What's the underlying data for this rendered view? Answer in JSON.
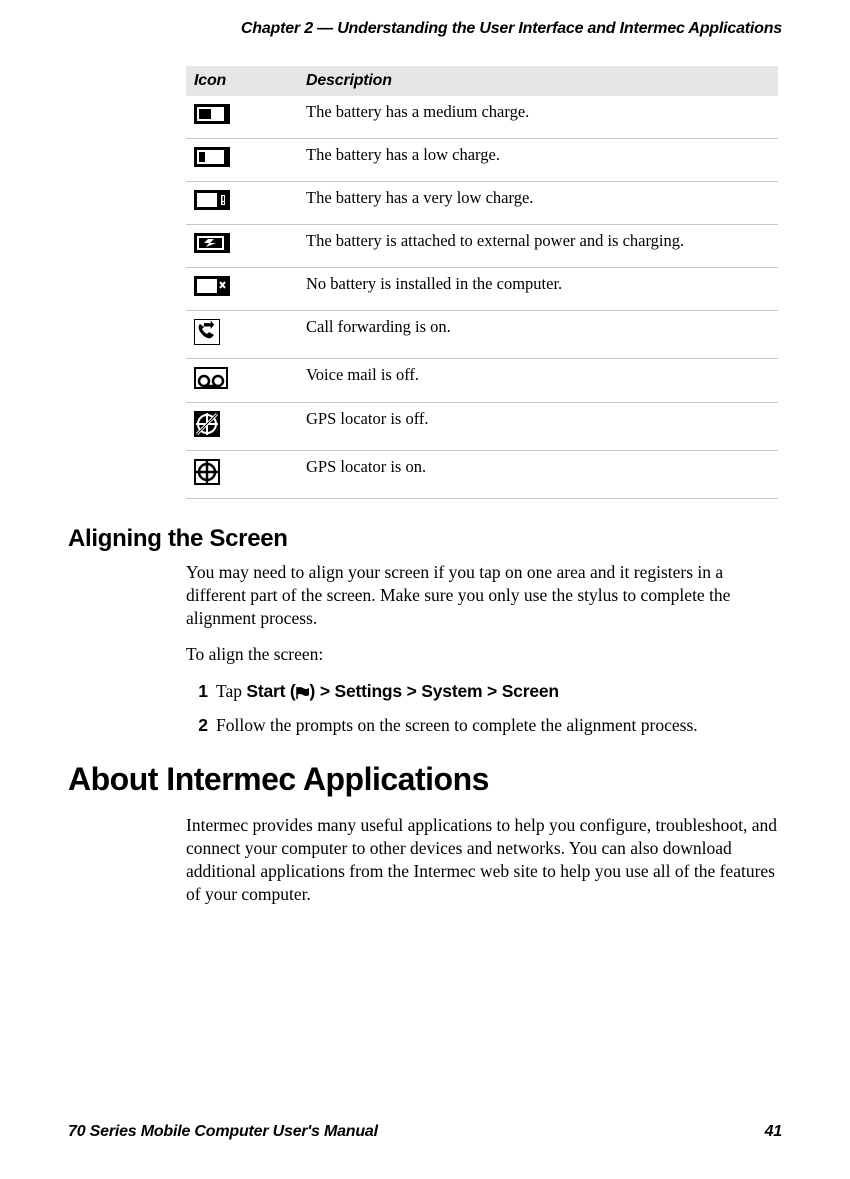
{
  "chapter_header": "Chapter 2 — Understanding the User Interface and Intermec Applications",
  "table": {
    "headers": {
      "icon": "Icon",
      "desc": "Description"
    },
    "rows": [
      {
        "icon": "battery-medium",
        "desc": "The battery has a medium charge."
      },
      {
        "icon": "battery-low",
        "desc": "The battery has a low charge."
      },
      {
        "icon": "battery-verylow",
        "desc": "The battery has a very low charge."
      },
      {
        "icon": "battery-charging",
        "desc": "The battery is attached to external power and is charging."
      },
      {
        "icon": "battery-missing",
        "desc": "No battery is installed in the computer."
      },
      {
        "icon": "call-forwarding",
        "desc": "Call forwarding is on."
      },
      {
        "icon": "voicemail-off",
        "desc": "Voice mail is off."
      },
      {
        "icon": "gps-off",
        "desc": "GPS locator is off."
      },
      {
        "icon": "gps-on",
        "desc": "GPS locator is on."
      }
    ]
  },
  "section1": {
    "heading": "Aligning the Screen",
    "p1": "You may need to align your screen if you tap on one area and it registers in a different part of the screen. Make sure you only use the stylus to complete the alignment process.",
    "p2": "To align the screen:",
    "step1_pre": "Tap ",
    "step1_bold": "Start (   ) > Settings > System > Screen",
    "step2": "Follow the prompts on the screen to complete the alignment process."
  },
  "section2": {
    "heading": "About Intermec Applications",
    "p1": "Intermec provides many useful applications to help you configure, troubleshoot, and connect your computer to other devices and networks. You can also download additional applications from the Intermec web site to help you use all of the features of your computer."
  },
  "footer": {
    "left": "70 Series Mobile Computer User's Manual",
    "right": "41"
  }
}
